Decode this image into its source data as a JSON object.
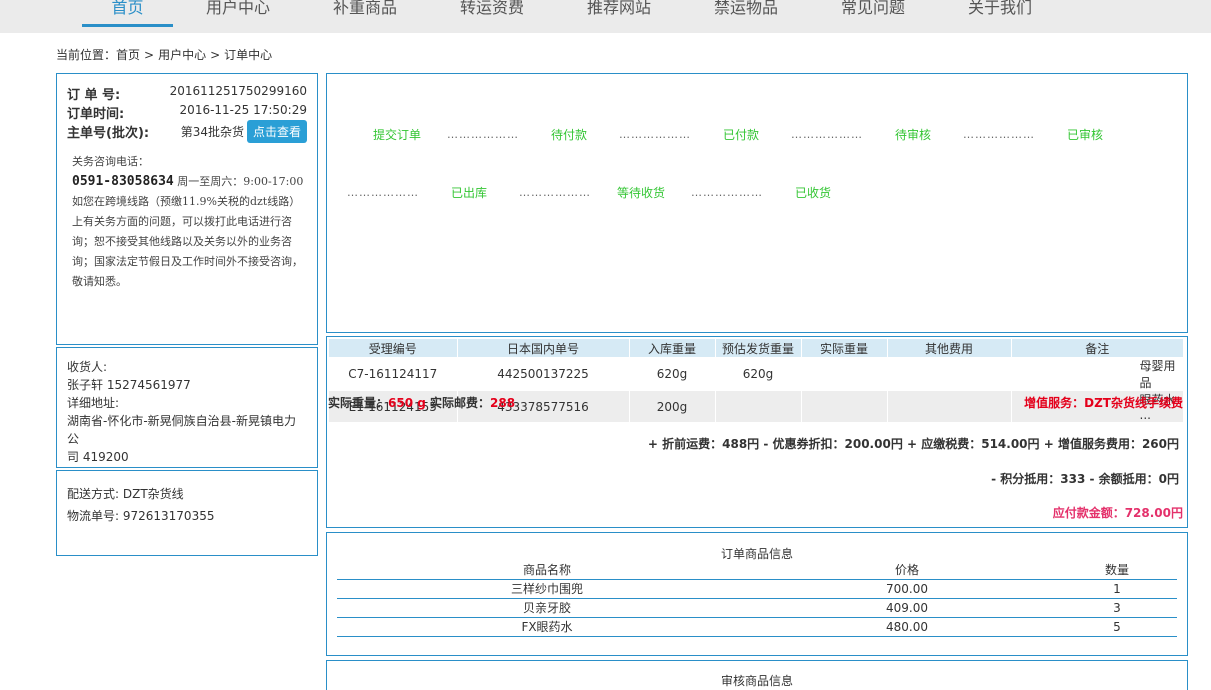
{
  "nav": {
    "items": [
      {
        "label": "首页",
        "active": true
      },
      {
        "label": "用户中心",
        "active": false
      },
      {
        "label": "补重商品",
        "active": false
      },
      {
        "label": "转运资费",
        "active": false
      },
      {
        "label": "推荐网站",
        "active": false
      },
      {
        "label": "禁运物品",
        "active": false
      },
      {
        "label": "常见问题",
        "active": false
      },
      {
        "label": "关于我们",
        "active": false
      }
    ]
  },
  "breadcrumb": {
    "prefix": "当前位置：",
    "home": "首页",
    "sep": ">",
    "user_center": "用户中心",
    "current": "订单中心"
  },
  "order": {
    "no_label": "订 单 号:",
    "no_value": "201611251750299160",
    "time_label": "订单时间:",
    "time_value": "2016-11-25 17:50:29",
    "master_label": "主单号(批次):",
    "master_value": "第34批杂货",
    "view_button": "点击查看"
  },
  "customs": {
    "heading": "关务咨询电话：",
    "phone": "0591-83058634",
    "hours": "周一至周六：9:00-17:00",
    "notice": "如您在跨境线路（预缴11.9%关税的dzt线路）上有关务方面的问题，可以拨打此电话进行咨询；恕不接受其他线路以及关务以外的业务咨询；国家法定节假日及工作时间外不接受咨询，敬请知悉。"
  },
  "receiver": {
    "label": "收货人:",
    "name_phone": "张子轩 15274561977",
    "addr_label": "详细地址:",
    "addr_line1": "湖南省-怀化市-新晃侗族自治县-新晃镇电力公",
    "addr_line2": "司 419200"
  },
  "shipping": {
    "method": "配送方式: DZT杂货线",
    "tracking": "物流单号: 972613170355"
  },
  "status_flow": {
    "steps": [
      "提交订单",
      "待付款",
      "已付款",
      "待审核",
      "已审核",
      "已出库",
      "等待收货",
      "已收货"
    ],
    "dots": "………………"
  },
  "receipt": {
    "headers": [
      "受理编号",
      "日本国内单号",
      "入库重量",
      "预估发货重量",
      "实际重量",
      "其他费用",
      "备注"
    ],
    "rows": [
      [
        "C7-161124117",
        "442500137225",
        "620g",
        "620g",
        "",
        "",
        "母婴用品"
      ],
      [
        "E1-161124155",
        "433378577516",
        "200g",
        "",
        "",
        "",
        "眼药水 ..."
      ]
    ],
    "actual_weight_label": "实际重量：",
    "actual_weight_value": "650 g",
    "postage_label": "实际邮费：",
    "postage_value": "288",
    "service": "增值服务：DZT杂货线手续费",
    "fee_line": "+ 折前运费：488円 - 优惠券折扣：200.00円 + 应缴税费：514.00円 + 增值服务费用：260円",
    "fee_line2_prefix": "- 积分抵用：333 - 余额抵用：0円",
    "total": "应付款金额：728.00円"
  },
  "goods": {
    "title": "订单商品信息",
    "headers": [
      "商品名称",
      "价格",
      "数量"
    ],
    "rows": [
      [
        "三样纱巾围兜",
        "700.00",
        "1"
      ],
      [
        "贝亲牙胶",
        "409.00",
        "3"
      ],
      [
        "FX眼药水",
        "480.00",
        "5"
      ]
    ]
  },
  "review": {
    "title": "审核商品信息"
  }
}
